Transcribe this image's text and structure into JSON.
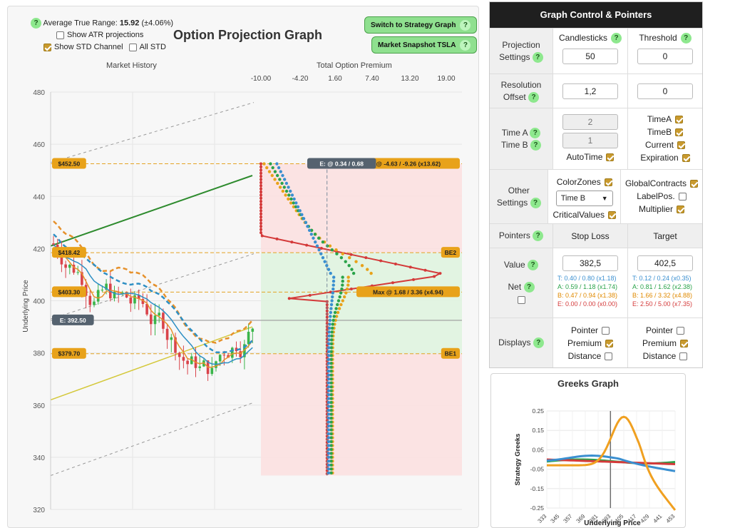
{
  "header": {
    "atr_label": "Average True Range:",
    "atr_value": "15.92",
    "atr_pct": "(±4.06%)",
    "show_atr_label": "Show ATR projections",
    "show_std_label": "Show STD Channel",
    "all_std_label": "All STD",
    "title": "Option Projection Graph",
    "switch_button": "Switch to Strategy Graph",
    "snapshot_button": "Market Snapshot TSLA",
    "help_glyph": "?",
    "market_history_label": "Market History",
    "premium_label": "Total Option Premium",
    "y_axis_label": "Underlying Price"
  },
  "chart_data": {
    "type": "line",
    "y_ticks": [
      "480",
      "460",
      "440",
      "420",
      "400",
      "380",
      "360",
      "340",
      "320"
    ],
    "x_ticks": [
      "-10.00",
      "-4.20",
      "1.60",
      "7.40",
      "13.20",
      "19.00"
    ],
    "price_tags": [
      "$452.50",
      "$418.42",
      "$403.30",
      "E: 392.50",
      "$379.70"
    ],
    "right_tags": [
      "Min @ -4.63 / -9.26 (x13.62)",
      "BE2",
      "Max @ 1.68 / 3.36 (x4.94)",
      "BE1"
    ],
    "current_tag": "E: @ 0.34 / 0.68"
  },
  "control": {
    "title": "Graph Control & Pointers",
    "projection_label": "Projection Settings",
    "candlesticks_label": "Candlesticks",
    "candlesticks_value": "50",
    "threshold_label": "Threshold",
    "threshold_value": "0",
    "resolution_label": "Resolution Offset",
    "resolution_value": "1,2",
    "offset_value": "0",
    "time_label_a": "Time A",
    "time_label_b": "Time B",
    "time_a_value": "2",
    "time_b_value": "1",
    "autotime_label": "AutoTime",
    "time_a_chk": "TimeA",
    "time_b_chk": "TimeB",
    "current_chk": "Current",
    "expiration_chk": "Expiration",
    "other_label": "Other Settings",
    "colorzones_label": "ColorZones",
    "select_value": "Time B",
    "critical_label": "CriticalValues",
    "global_label": "GlobalContracts",
    "labelpos_label": "LabelPos.",
    "multiplier_label": "Multiplier",
    "pointers_label": "Pointers",
    "stoploss_label": "Stop Loss",
    "target_label": "Target",
    "value_label": "Value",
    "net_label": "Net",
    "stoploss_value": "382,5",
    "target_value": "402,5",
    "stoploss_stats": [
      {
        "text": "T: 0.40 / 0.80 (x1.18)",
        "color": "#3a8fd0"
      },
      {
        "text": "A: 0.59 / 1.18 (x1.74)",
        "color": "#2aa34a"
      },
      {
        "text": "B: 0.47 / 0.94 (x1.38)",
        "color": "#e08a00"
      },
      {
        "text": "E: 0.00 / 0.00 (x0.00)",
        "color": "#d43a3a"
      }
    ],
    "target_stats": [
      {
        "text": "T: 0.12 / 0.24 (x0.35)",
        "color": "#3a8fd0"
      },
      {
        "text": "A: 0.81 / 1.62 (x2.38)",
        "color": "#2aa34a"
      },
      {
        "text": "B: 1.66 / 3.32 (x4.88)",
        "color": "#e08a00"
      },
      {
        "text": "E: 2.50 / 5.00 (x7.35)",
        "color": "#d43a3a"
      }
    ],
    "displays_label": "Displays",
    "pointer_label": "Pointer",
    "premium_label": "Premium",
    "distance_label": "Distance"
  },
  "greeks": {
    "title": "Greeks Graph",
    "y_label": "Strategy Greeks",
    "x_label": "Underlying Price",
    "y_ticks": [
      "0.25",
      "0.15",
      "0.05",
      "-0.05",
      "-0.15",
      "-0.25"
    ],
    "x_ticks": [
      "333",
      "345",
      "357",
      "369",
      "381",
      "393",
      "405",
      "417",
      "429",
      "441",
      "453"
    ]
  }
}
